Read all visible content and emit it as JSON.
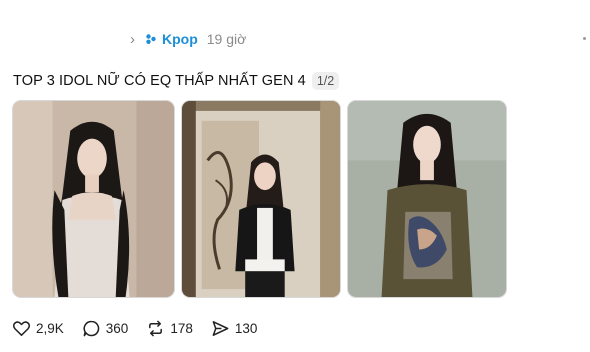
{
  "post": {
    "topic": "Kpop",
    "time": "19 giờ",
    "title": "TOP 3 IDOL NỮ CÓ EQ THẤP NHẤT GEN 4",
    "page_count": "1/2"
  },
  "photos": [
    {
      "subject": "woman in white satin slip dress, long wavy dark hair"
    },
    {
      "subject": "woman in black and white outfit posing in hallway"
    },
    {
      "subject": "woman in olive mesh top with graphic print"
    }
  ],
  "actions": {
    "likes": "2,9K",
    "comments": "360",
    "reposts": "178",
    "shares": "130"
  },
  "colors": {
    "topic": "#1d8fd8",
    "muted": "#8a8a8a"
  },
  "icons": [
    "chevron-right-icon",
    "topic-icon",
    "more-icon",
    "heart-icon",
    "comment-icon",
    "repost-icon",
    "share-icon"
  ]
}
